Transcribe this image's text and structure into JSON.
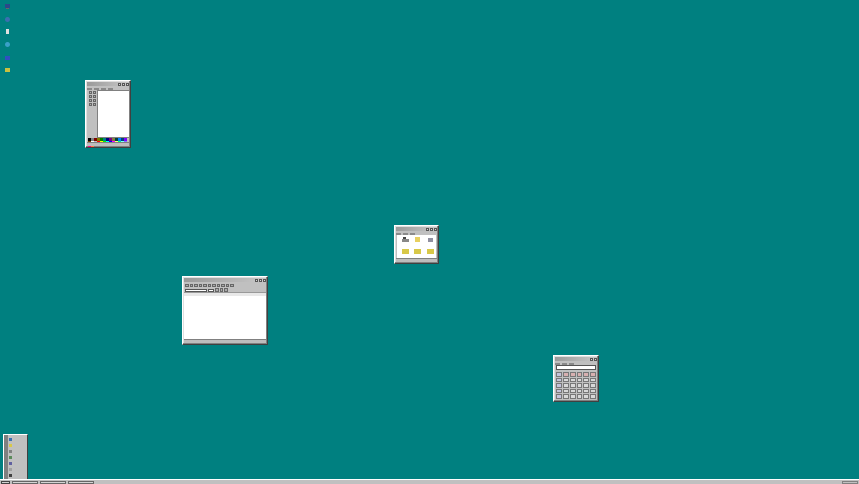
{
  "desktop": {
    "background_color": "#008080",
    "icons": [
      {
        "name": "my-computer-icon"
      },
      {
        "name": "network-icon"
      },
      {
        "name": "recycle-bin-icon"
      },
      {
        "name": "internet-icon"
      },
      {
        "name": "briefcase-icon"
      },
      {
        "name": "folder-icon"
      }
    ]
  },
  "windows": {
    "paint": {
      "palette_colors": [
        "#000000",
        "#808080",
        "#800000",
        "#808000",
        "#008000",
        "#008080",
        "#000080",
        "#800080",
        "#808040",
        "#004040",
        "#0080ff",
        "#004080",
        "#8000ff",
        "#804000",
        "#ffffff",
        "#c0c0c0",
        "#ff0000",
        "#ffff00",
        "#00ff00",
        "#00ffff",
        "#0000ff",
        "#ff00ff",
        "#ffff80",
        "#00ff80",
        "#80ffff",
        "#8080ff",
        "#ff0080",
        "#ff8040"
      ]
    },
    "calculator": {
      "accent_colors": {
        "function_keys": "#d8b0b0",
        "memory_keys": "#c4c4dc"
      }
    }
  },
  "taskbar": {}
}
